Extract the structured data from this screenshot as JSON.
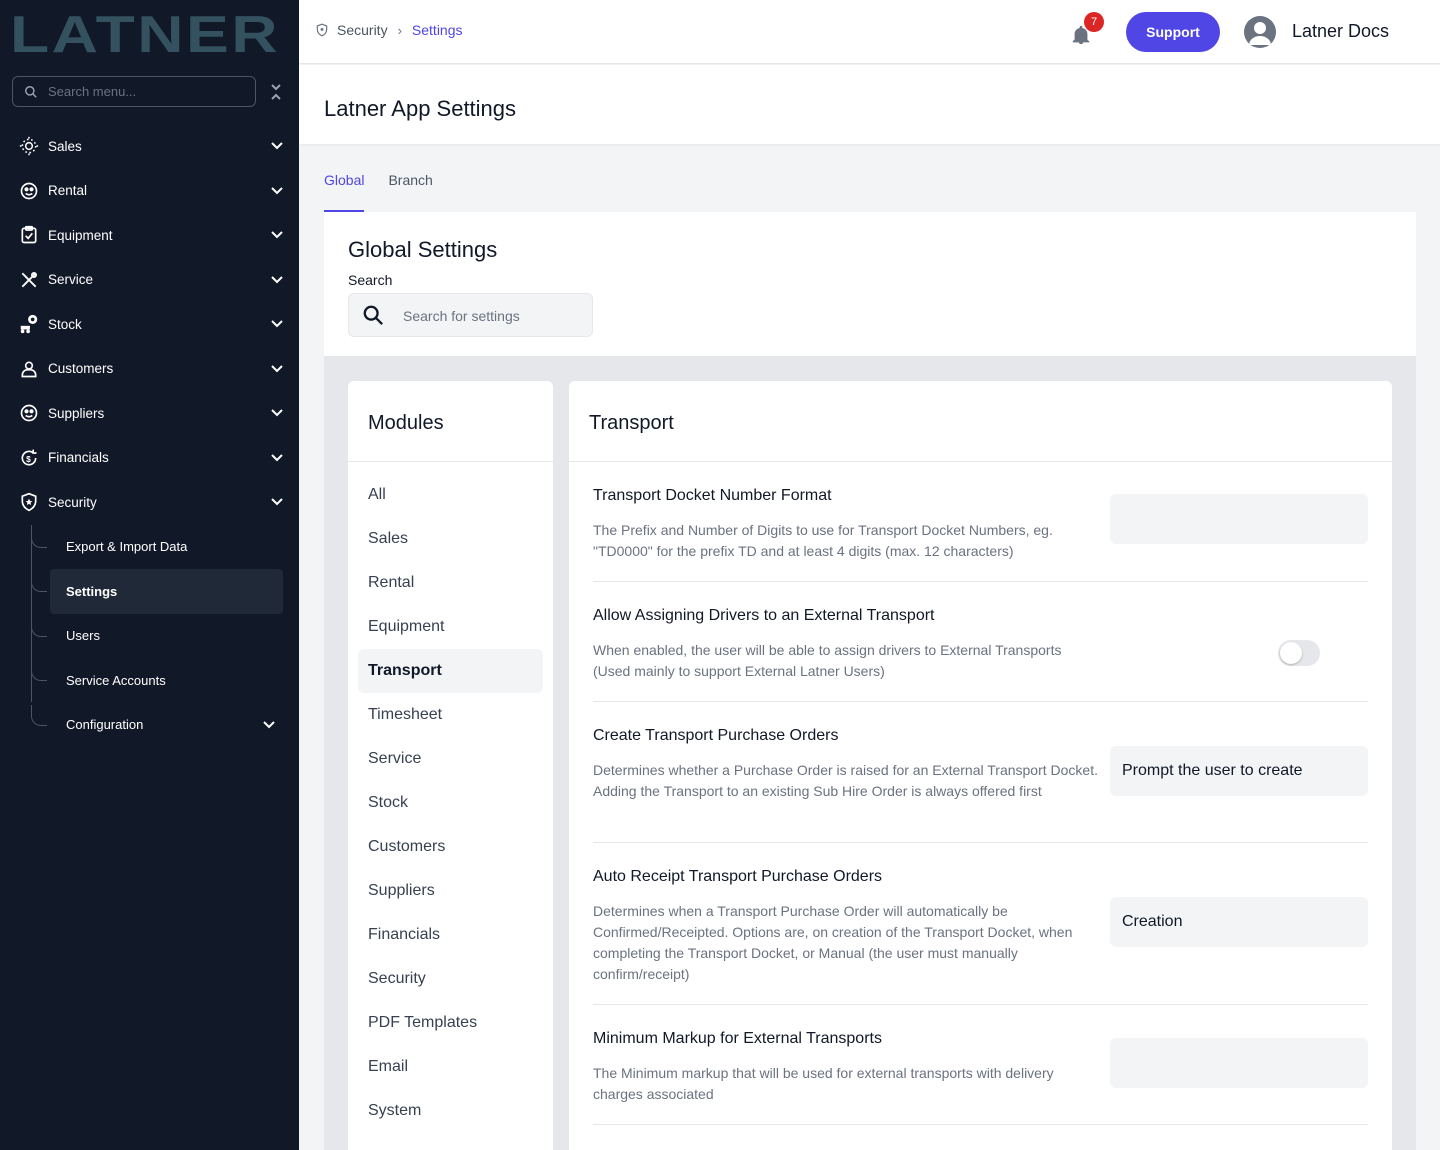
{
  "brand": {
    "logo_text": "LATNER",
    "accent": "#4f46e5"
  },
  "sidebar": {
    "search_placeholder": "Search menu...",
    "items": [
      {
        "label": "Sales",
        "icon": "sales-icon"
      },
      {
        "label": "Rental",
        "icon": "rental-icon"
      },
      {
        "label": "Equipment",
        "icon": "equipment-icon"
      },
      {
        "label": "Service",
        "icon": "service-tools-icon"
      },
      {
        "label": "Stock",
        "icon": "stock-icon"
      },
      {
        "label": "Customers",
        "icon": "user-icon"
      },
      {
        "label": "Suppliers",
        "icon": "suppliers-icon"
      },
      {
        "label": "Financials",
        "icon": "financials-icon"
      },
      {
        "label": "Security",
        "icon": "shield-icon"
      }
    ],
    "security_sub": [
      {
        "label": "Export & Import Data"
      },
      {
        "label": "Settings"
      },
      {
        "label": "Users"
      },
      {
        "label": "Service Accounts"
      },
      {
        "label": "Configuration"
      }
    ]
  },
  "header": {
    "breadcrumb": {
      "parent": "Security",
      "current": "Settings"
    },
    "notification_count": "7",
    "support_label": "Support",
    "user_name": "Latner Docs"
  },
  "page": {
    "title": "Latner App Settings"
  },
  "tabs": [
    {
      "label": "Global"
    },
    {
      "label": "Branch"
    }
  ],
  "global_settings": {
    "title": "Global Settings",
    "search_label": "Search",
    "search_placeholder": "Search for settings"
  },
  "modules": {
    "title": "Modules",
    "items": [
      "All",
      "Sales",
      "Rental",
      "Equipment",
      "Transport",
      "Timesheet",
      "Service",
      "Stock",
      "Customers",
      "Suppliers",
      "Financials",
      "Security",
      "PDF Templates",
      "Email",
      "System"
    ],
    "selected": "Transport"
  },
  "transport": {
    "title": "Transport",
    "settings": [
      {
        "title": "Transport Docket Number Format",
        "desc": "The Prefix and Number of Digits to use for Transport Docket Numbers, eg. \"TD0000\" for the prefix TD and at least 4 digits (max. 12 characters)",
        "value": ""
      },
      {
        "title": "Allow Assigning Drivers to an External Transport",
        "desc": "When enabled, the user will be able to assign drivers to External Transports (Used mainly to support External Latner Users)",
        "toggle": false
      },
      {
        "title": "Create Transport Purchase Orders",
        "desc": "Determines whether a Purchase Order is raised for an External Transport Docket. Adding the Transport to an existing Sub Hire Order is always offered first",
        "value": "Prompt the user to create"
      },
      {
        "title": "Auto Receipt Transport Purchase Orders",
        "desc": "Determines when a Transport Purchase Order will automatically be Confirmed/Receipted. Options are, on creation of the Transport Docket, when completing the Transport Docket, or Manual (the user must manually confirm/receipt)",
        "value": "Creation"
      },
      {
        "title": "Minimum Markup for External Transports",
        "desc": "The Minimum markup that will be used for external transports with delivery charges associated",
        "value": ""
      }
    ]
  }
}
